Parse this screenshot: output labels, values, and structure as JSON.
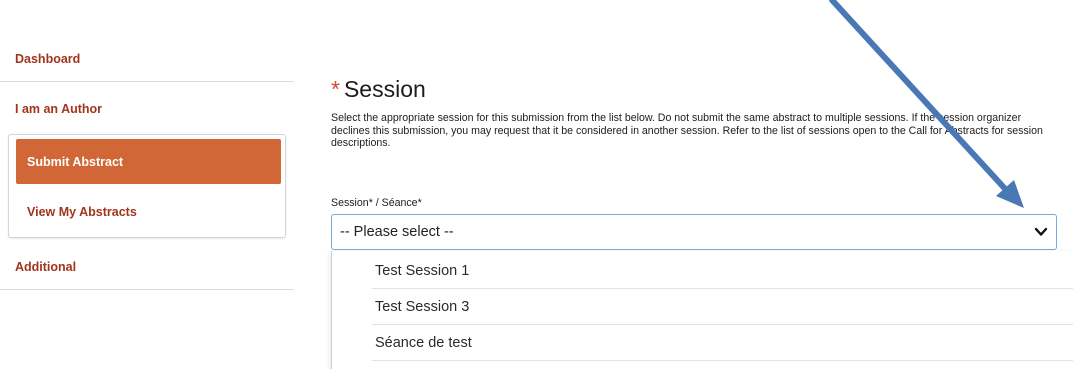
{
  "sidebar": {
    "items": [
      {
        "label": "Dashboard"
      },
      {
        "label": "I am an Author"
      },
      {
        "label": "Submit Abstract"
      },
      {
        "label": "View My Abstracts"
      },
      {
        "label": "Additional"
      }
    ]
  },
  "main": {
    "required_mark": "*",
    "title": "Session",
    "description": "Select the appropriate session for this submission from the list below.  Do not submit the same abstract to multiple sessions.  If the session organizer declines this submission, you may request that it be considered in another session. Refer to the list of sessions open to the Call for Abstracts for session descriptions.",
    "field_label": "Session* / Séance*",
    "select_value": "-- Please select --",
    "options": [
      {
        "label": "Test Session 1"
      },
      {
        "label": "Test Session 3"
      },
      {
        "label": "Séance de test"
      }
    ]
  },
  "annotation": {
    "arrow_color": "#4a78b5",
    "chevron_icon": "chevron-down-icon"
  }
}
